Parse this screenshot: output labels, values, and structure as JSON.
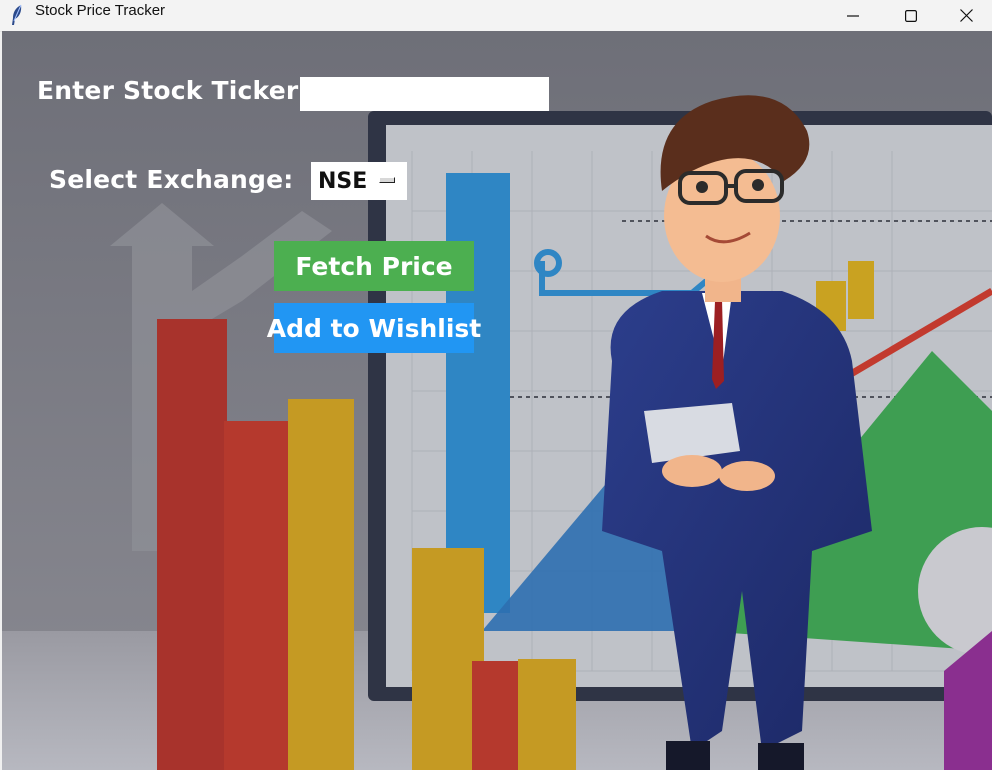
{
  "window": {
    "title": "Stock Price Tracker",
    "icon": "feather-icon",
    "controls": [
      "minimize-icon",
      "maximize-icon",
      "close-icon"
    ]
  },
  "form": {
    "ticker_label": "Enter Stock Ticker:",
    "ticker_value": "",
    "exchange_label": "Select Exchange:",
    "exchange_value": "NSE"
  },
  "buttons": {
    "fetch_label": "Fetch Price",
    "wishlist_label": "Add to Wishlist"
  },
  "colors": {
    "fetch_button": "#4caf50",
    "wishlist_button": "#2196f3",
    "label_text": "#ffffff"
  }
}
